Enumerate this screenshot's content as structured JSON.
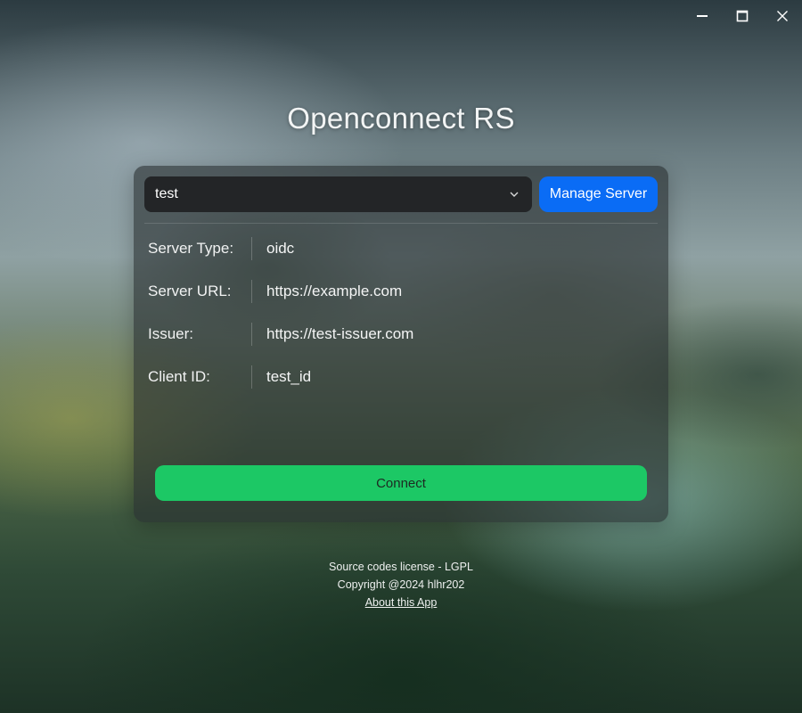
{
  "window": {
    "controls": [
      {
        "name": "minimize",
        "icon": "minimize-icon"
      },
      {
        "name": "maximize",
        "icon": "maximize-icon"
      },
      {
        "name": "close",
        "icon": "close-icon"
      }
    ]
  },
  "app": {
    "title": "Openconnect RS"
  },
  "server_select": {
    "selected": "test",
    "icon": "chevron-down-icon"
  },
  "manage_server_label": "Manage Server",
  "details": [
    {
      "label": "Server Type:",
      "value": "oidc"
    },
    {
      "label": "Server URL:",
      "value": "https://example.com"
    },
    {
      "label": "Issuer:",
      "value": "https://test-issuer.com"
    },
    {
      "label": "Client ID:",
      "value": "test_id"
    }
  ],
  "connect_label": "Connect",
  "footer": {
    "license": "Source codes license - LGPL",
    "copyright": "Copyright @2024 hlhr202",
    "about_link": "About this App"
  },
  "colors": {
    "accent_blue": "#0a6cf5",
    "connect_green": "#1cc865",
    "card_bg": "#282e30",
    "select_bg": "#232527"
  }
}
